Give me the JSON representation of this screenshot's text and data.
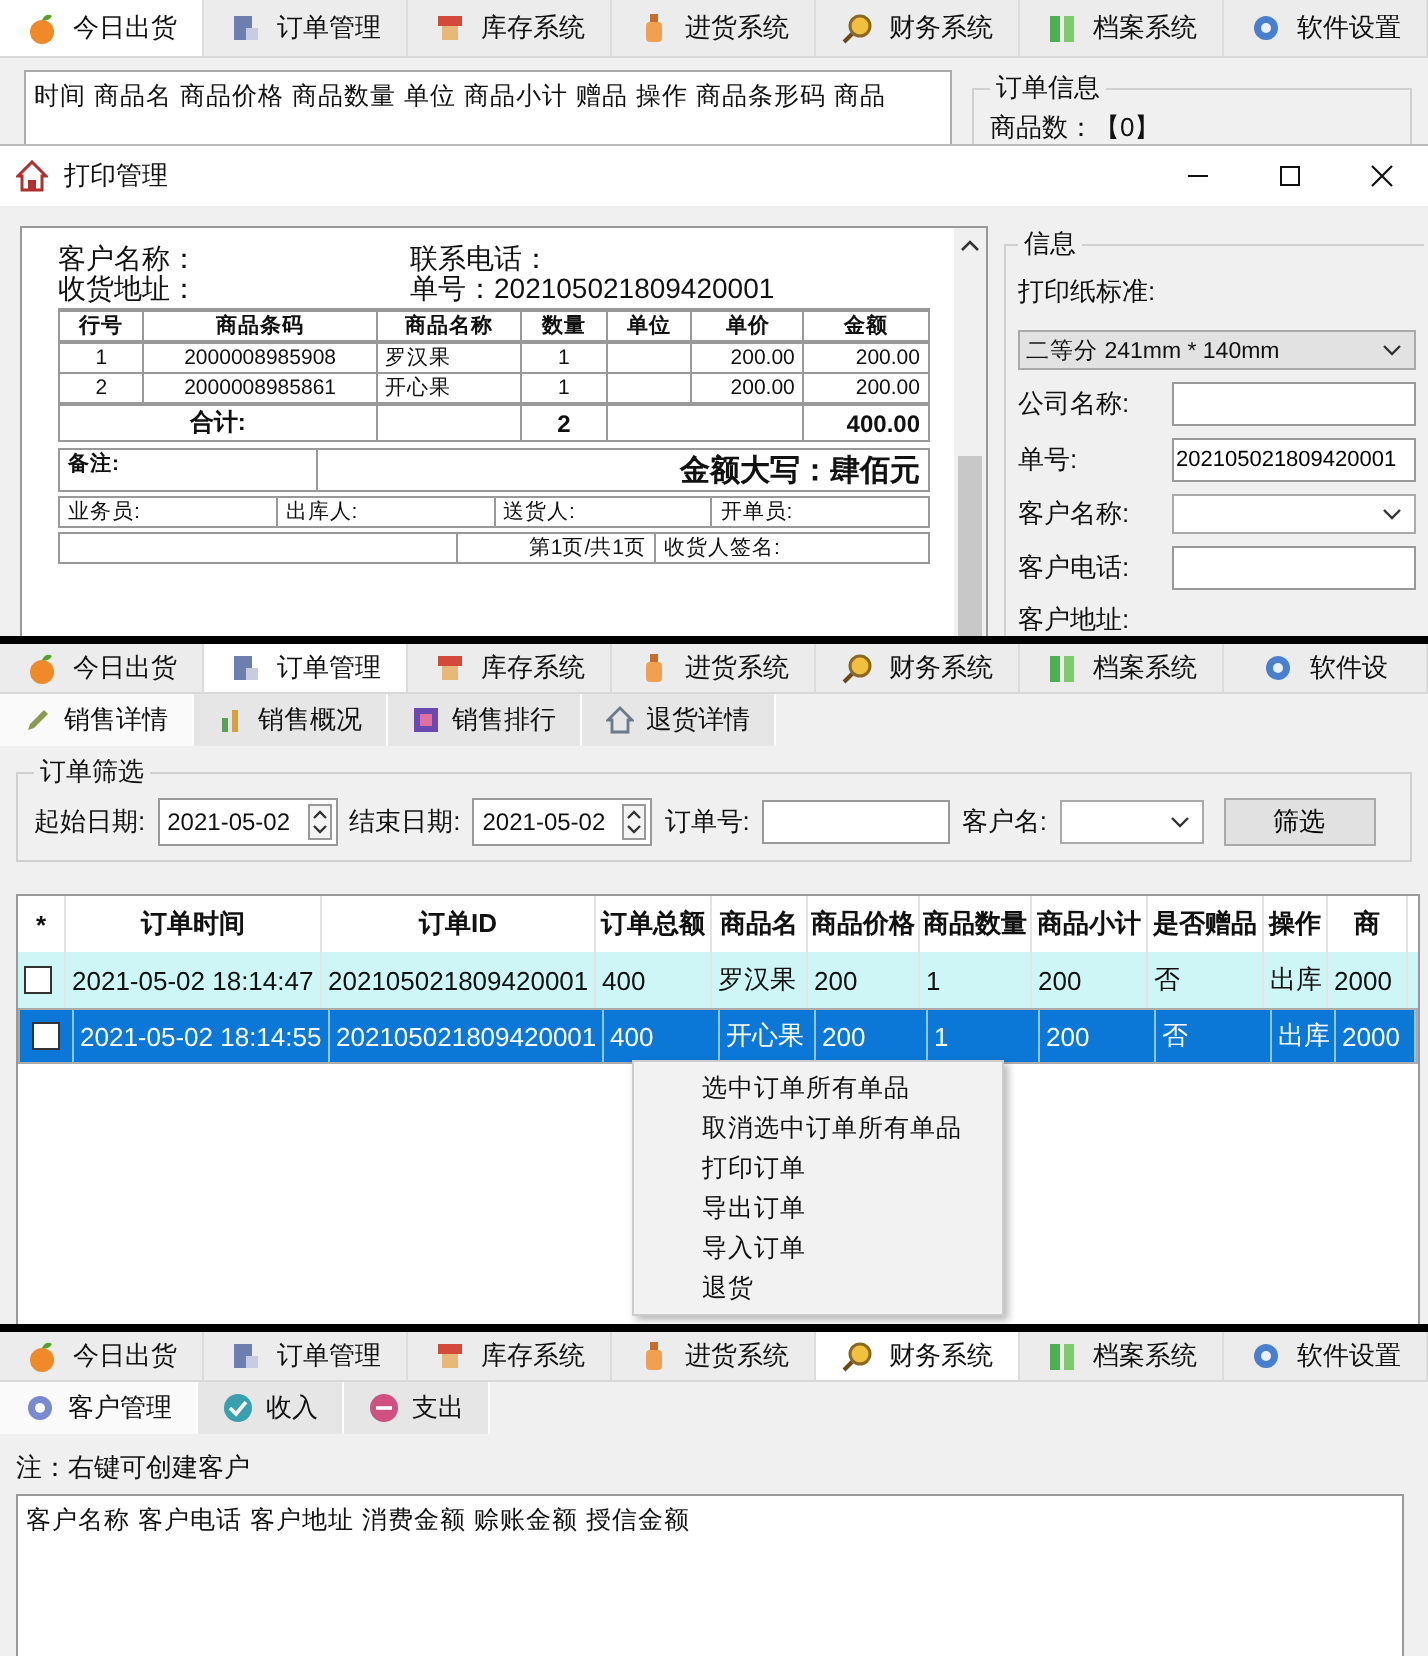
{
  "screens": [
    {
      "kind": "print_dialog",
      "tabs": [
        {
          "label": "今日出货",
          "selected": true
        },
        {
          "label": "订单管理",
          "selected": false
        },
        {
          "label": "库存系统",
          "selected": false
        },
        {
          "label": "进货系统",
          "selected": false
        },
        {
          "label": "财务系统",
          "selected": false
        },
        {
          "label": "档案系统",
          "selected": false
        },
        {
          "label": "软件设置",
          "selected": false
        }
      ],
      "order_table": {
        "columns": [
          "时间",
          "商品名",
          "商品价格",
          "商品数量",
          "单位",
          "商品小计",
          "赠品",
          "操作",
          "商品条形码",
          "商品"
        ]
      },
      "order_info": {
        "title": "订单信息",
        "item_count": "商品数：【0】"
      },
      "dialog": {
        "title": "打印管理",
        "receipt": {
          "header": [
            "客户名称：",
            "联系电话：",
            "收货地址：",
            "单号：202105021809420001"
          ],
          "columns": [
            "行号",
            "商品条码",
            "商品名称",
            "数量",
            "单位",
            "单价",
            "金额"
          ],
          "rows": [
            {
              "line": "1",
              "barcode": "2000008985908",
              "name": "罗汉果",
              "qty": "1",
              "price": "200.00",
              "amount": "200.00"
            },
            {
              "line": "2",
              "barcode": "2000008985861",
              "name": "开心果",
              "qty": "1",
              "price": "200.00",
              "amount": "200.00"
            }
          ],
          "total": {
            "label": "合计:",
            "qty": "2",
            "amount": "400.00"
          },
          "remark_label": "备注:",
          "amount_words": "金额大写：肆佰元",
          "staff": [
            "业务员:",
            "出库人:",
            "送货人:",
            "开单员:"
          ],
          "page": "第1页/共1页",
          "signature": "收货人签名:"
        },
        "info": {
          "title": "信息",
          "fields": [
            {
              "kind": "wide_select",
              "label": "打印纸标准:",
              "value": "二等分 241mm * 140mm"
            },
            {
              "kind": "text",
              "label": "公司名称:"
            },
            {
              "kind": "text",
              "label": "单号:",
              "value": "202105021809420001"
            },
            {
              "kind": "select",
              "label": "客户名称:"
            },
            {
              "kind": "text",
              "label": "客户电话:"
            },
            {
              "kind": "textarea",
              "label": "客户地址:"
            }
          ]
        }
      }
    },
    {
      "kind": "orders",
      "tabs": [
        {
          "label": "今日出货",
          "selected": false
        },
        {
          "label": "订单管理",
          "selected": true
        },
        {
          "label": "库存系统",
          "selected": false
        },
        {
          "label": "进货系统",
          "selected": false
        },
        {
          "label": "财务系统",
          "selected": false
        },
        {
          "label": "档案系统",
          "selected": false
        },
        {
          "label": "软件设",
          "selected": false
        }
      ],
      "subtabs": [
        {
          "label": "销售详情",
          "selected": true
        },
        {
          "label": "销售概况",
          "selected": false
        },
        {
          "label": "销售排行",
          "selected": false
        },
        {
          "label": "退货详情",
          "selected": false
        }
      ],
      "filter": {
        "title": "订单筛选",
        "start_label": "起始日期:",
        "start_date": "2021-05-02",
        "end_label": "结束日期:",
        "end_date": "2021-05-02",
        "order_label": "订单号:",
        "customer_label": "客户名:",
        "button": "筛选"
      },
      "grid": {
        "check_column": "*",
        "columns": [
          "订单时间",
          "订单ID",
          "订单总额",
          "商品名",
          "商品价格",
          "商品数量",
          "商品小计",
          "是否赠品",
          "操作",
          "商"
        ],
        "rows": [
          {
            "checked": false,
            "selected": false,
            "cells": [
              "2021-05-02 18:14:47",
              "202105021809420001",
              "400",
              "罗汉果",
              "200",
              "1",
              "200",
              "否",
              "出库",
              "2000"
            ]
          },
          {
            "checked": false,
            "selected": true,
            "cells": [
              "2021-05-02 18:14:55",
              "202105021809420001",
              "400",
              "开心果",
              "200",
              "1",
              "200",
              "否",
              "出库",
              "2000"
            ]
          }
        ]
      },
      "context_menu": {
        "items": [
          "选中订单所有单品",
          "取消选中订单所有单品",
          "打印订单",
          "导出订单",
          "导入订单",
          "退货"
        ]
      }
    },
    {
      "kind": "customers",
      "tabs": [
        {
          "label": "今日出货",
          "selected": false
        },
        {
          "label": "订单管理",
          "selected": false
        },
        {
          "label": "库存系统",
          "selected": false
        },
        {
          "label": "进货系统",
          "selected": false
        },
        {
          "label": "财务系统",
          "selected": true
        },
        {
          "label": "档案系统",
          "selected": false
        },
        {
          "label": "软件设置",
          "selected": false
        }
      ],
      "subtabs": [
        {
          "label": "客户管理",
          "selected": true
        },
        {
          "label": "收入",
          "selected": false
        },
        {
          "label": "支出",
          "selected": false
        }
      ],
      "note": "注：右键可创建客户",
      "columns": [
        "客户名称",
        "客户电话",
        "客户地址",
        "消费金额",
        "赊账金额",
        "授信金额"
      ]
    }
  ]
}
